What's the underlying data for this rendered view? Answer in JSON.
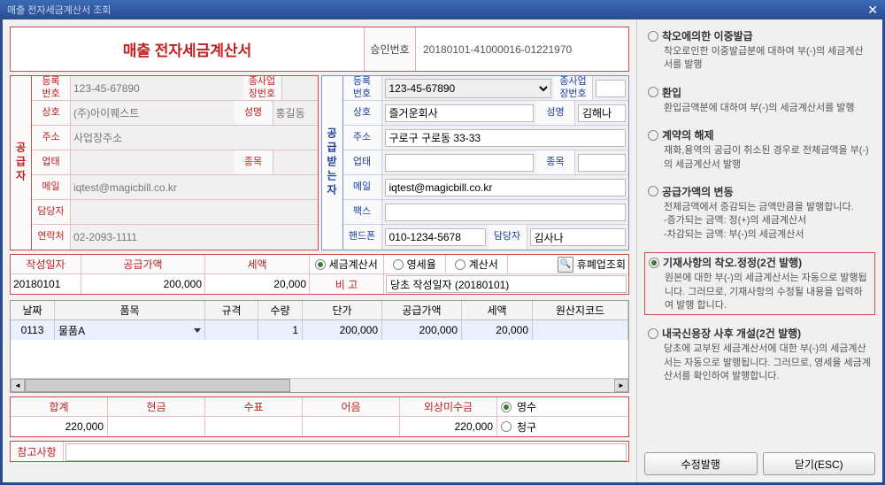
{
  "window_title": "매출 전자세금계산서 조회",
  "doc_title": "매출 전자세금계산서",
  "approval": {
    "label": "승인번호",
    "value": "20180101-41000016-01221970"
  },
  "supplier": {
    "vlabel": "공급자",
    "reg_label": "등록\n번호",
    "reg": "123-45-67890",
    "sub_label": "종사업\n장번호",
    "sub": "",
    "name_label": "상호",
    "name": "(주)아이퀘스트",
    "rep_label": "성명",
    "rep": "홍길동",
    "addr_label": "주소",
    "addr": "사업장주소",
    "biz_label": "업태",
    "biz": "",
    "item_label": "종목",
    "item": "",
    "email_label": "메일",
    "email": "iqtest@magicbill.co.kr",
    "mgr_label": "담당자",
    "mgr": "",
    "phone_label": "연락처",
    "phone": "02-2093-1111"
  },
  "buyer": {
    "vlabel": "공급받는자",
    "reg_label": "등록\n번호",
    "reg": "123-45-67890",
    "sub_label": "종사업\n장번호",
    "sub": "",
    "name_label": "상호",
    "name": "즐거운회사",
    "rep_label": "성명",
    "rep": "김해나",
    "addr_label": "주소",
    "addr": "구로구 구로동 33-33",
    "biz_label": "업태",
    "biz": "",
    "item_label": "종목",
    "item": "",
    "email_label": "메일",
    "email": "iqtest@magicbill.co.kr",
    "fax_label": "팩스",
    "fax": "",
    "hp_label": "핸드폰",
    "hp": "010-1234-5678",
    "mgr_label": "담당자",
    "mgr": "김사나"
  },
  "meta": {
    "date_label": "작성일자",
    "supply_label": "공급가액",
    "tax_label": "세액",
    "date": "20180101",
    "supply": "200,000",
    "tax": "20,000",
    "type1": "세금계산서",
    "type2": "영세율",
    "type3": "계산서",
    "closed_btn": "휴폐업조회",
    "remark_label": "비 고",
    "remark": "당초 작성일자 (20180101)"
  },
  "items": {
    "hdr": {
      "date": "날짜",
      "name": "품목",
      "spec": "규격",
      "qty": "수량",
      "price": "단가",
      "supply": "공급가액",
      "tax": "세액",
      "origin": "원산지코드"
    },
    "rows": [
      {
        "date": "0113",
        "name": "물품A",
        "spec": "",
        "qty": "1",
        "price": "200,000",
        "supply": "200,000",
        "tax": "20,000",
        "origin": ""
      }
    ]
  },
  "totals": {
    "sum_label": "합계",
    "cash_label": "현금",
    "check_label": "수표",
    "note_label": "어음",
    "credit_label": "외상미수금",
    "sum": "220,000",
    "cash": "",
    "check": "",
    "note": "",
    "credit": "220,000",
    "receipt": "영수",
    "invoice": "청구"
  },
  "ref_label": "참고사항",
  "side": {
    "opts": [
      {
        "title": "착오에의한 이중발급",
        "desc": "착오로인한 이중발급분에 대하여 부(-)의 세금계산서를 발행",
        "selected": false
      },
      {
        "title": "환입",
        "desc": "환입금액분에 대하여 부(-)의 세금계산서를 발행",
        "selected": false
      },
      {
        "title": "계약의 해제",
        "desc": "재화,용역의 공급이 취소된 경우로 전체금액을 부(-)의 세금계산서 발행",
        "selected": false
      },
      {
        "title": "공급가액의 변동",
        "desc": "전체금액에서 증감되는 금액만큼을 발행합니다.\n-증가되는 금액: 정(+)의 세금계산서\n-차감되는 금액: 부(-)의 세금계산서",
        "selected": false
      },
      {
        "title": "기재사항의 착오.정정(2건 발행)",
        "desc": "원본에 대한 부(-)의 세금계산서는 자동으로 발행됩니다. 그러므로, 기재사항의 수정될 내용을 입력하여 발행 합니다.",
        "selected": true
      },
      {
        "title": "내국신용장 사후 개설(2건 발행)",
        "desc": "당초에 교부된 세금계산서에 대한 부(-)의 세금계산서는 자동으로 발행됩니다. 그러므로, 영세율 세금계산서를 확인하여 발행합니다.",
        "selected": false
      }
    ],
    "btn_issue": "수정발행",
    "btn_close": "닫기(ESC)"
  }
}
